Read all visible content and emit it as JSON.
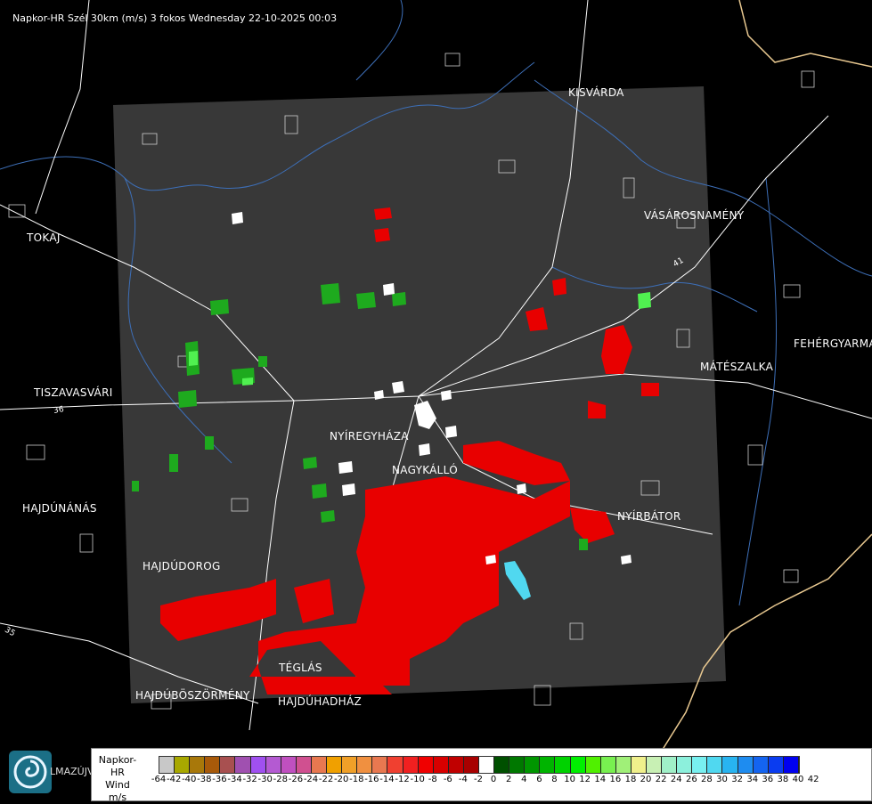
{
  "title": "Napkor-HR Szél 30km (m/s) 3 fokos Wednesday 22-10-2025 00:03",
  "cities": [
    {
      "name": "KISVÁRDA"
    },
    {
      "name": "TOKAJ"
    },
    {
      "name": "VÁSÁROSNAMÉNY"
    },
    {
      "name": "FEHÉRGYARMAT"
    },
    {
      "name": "MÁTÉSZALKA"
    },
    {
      "name": "TISZAVASVÁRI"
    },
    {
      "name": "NYÍREGYHÁZA"
    },
    {
      "name": "NAGYKÁLLÓ"
    },
    {
      "name": "NYÍRBÁTOR"
    },
    {
      "name": "HAJDÚNÁNÁS"
    },
    {
      "name": "HAJDÚDOROG"
    },
    {
      "name": "TÉGLÁS"
    },
    {
      "name": "HAJDÚBÖSZÖRMÉNY"
    },
    {
      "name": "HAJDÚHADHÁZ"
    }
  ],
  "road_numbers": [
    "36",
    "41",
    "35"
  ],
  "logo_text": "LMAZÚJVÁR",
  "legend": {
    "line1": "Napkor-HR",
    "line2": "Wind",
    "line3": "m/s",
    "colors": [
      "#c8c8c8",
      "#a8a800",
      "#a8780a",
      "#a85a0a",
      "#a85050",
      "#a050b0",
      "#a050f0",
      "#b45ad2",
      "#c050c0",
      "#d05090",
      "#e87850",
      "#f0a000",
      "#f0a028",
      "#f09040",
      "#e87850",
      "#f04030",
      "#f02020",
      "#f00000",
      "#d80000",
      "#c00000",
      "#a80000",
      "#ffffff",
      "#005000",
      "#007800",
      "#009600",
      "#00b400",
      "#00d200",
      "#00f000",
      "#50f000",
      "#78f050",
      "#a0f078",
      "#f0f08c",
      "#c8f0b4",
      "#a0f0c8",
      "#8cf0dc",
      "#78f0f0",
      "#50d8f0",
      "#28b4f0",
      "#1e8cf0",
      "#1464f0",
      "#0a3cf0",
      "#0000f0"
    ],
    "ticks": [
      "-64",
      "-42",
      "-40",
      "-38",
      "-36",
      "-34",
      "-32",
      "-30",
      "-28",
      "-26",
      "-24",
      "-22",
      "-20",
      "-18",
      "-16",
      "-14",
      "-12",
      "-10",
      "-8",
      "-6",
      "-4",
      "-2",
      "0",
      "2",
      "4",
      "6",
      "8",
      "10",
      "12",
      "14",
      "16",
      "18",
      "20",
      "22",
      "24",
      "26",
      "28",
      "30",
      "32",
      "34",
      "36",
      "38",
      "40",
      "42"
    ]
  }
}
